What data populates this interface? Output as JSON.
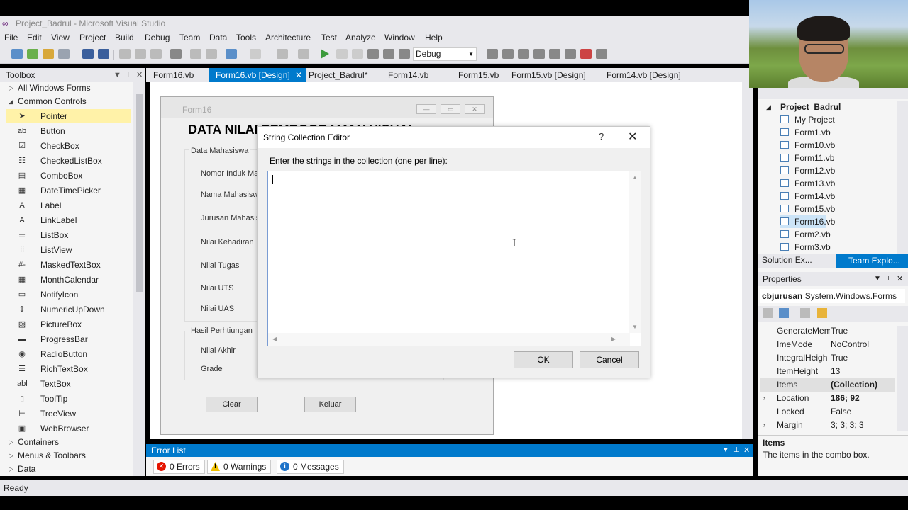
{
  "window": {
    "title": "Project_Badrul - Microsoft Visual Studio"
  },
  "menu": [
    "File",
    "Edit",
    "View",
    "Project",
    "Build",
    "Debug",
    "Team",
    "Data",
    "Tools",
    "Architecture",
    "Test",
    "Analyze",
    "Window",
    "Help"
  ],
  "toolbar": {
    "config_value": "Debug"
  },
  "toolbox": {
    "title": "Toolbox",
    "groups": {
      "all": "All Windows Forms",
      "common": "Common Controls",
      "containers": "Containers",
      "menus": "Menus & Toolbars",
      "data": "Data"
    },
    "items": [
      {
        "label": "Pointer",
        "icon": "pointer-icon",
        "glyph": "➤"
      },
      {
        "label": "Button",
        "icon": "button-icon",
        "glyph": "ab"
      },
      {
        "label": "CheckBox",
        "icon": "checkbox-icon",
        "glyph": "☑"
      },
      {
        "label": "CheckedListBox",
        "icon": "checkedlistbox-icon",
        "glyph": "☷"
      },
      {
        "label": "ComboBox",
        "icon": "combobox-icon",
        "glyph": "▤"
      },
      {
        "label": "DateTimePicker",
        "icon": "datetimepicker-icon",
        "glyph": "▦"
      },
      {
        "label": "Label",
        "icon": "label-icon",
        "glyph": "A"
      },
      {
        "label": "LinkLabel",
        "icon": "linklabel-icon",
        "glyph": "A"
      },
      {
        "label": "ListBox",
        "icon": "listbox-icon",
        "glyph": "☰"
      },
      {
        "label": "ListView",
        "icon": "listview-icon",
        "glyph": "⁞⁞"
      },
      {
        "label": "MaskedTextBox",
        "icon": "maskedtextbox-icon",
        "glyph": "#-"
      },
      {
        "label": "MonthCalendar",
        "icon": "monthcalendar-icon",
        "glyph": "▦"
      },
      {
        "label": "NotifyIcon",
        "icon": "notifyicon-icon",
        "glyph": "▭"
      },
      {
        "label": "NumericUpDown",
        "icon": "numericupdown-icon",
        "glyph": "⇕"
      },
      {
        "label": "PictureBox",
        "icon": "picturebox-icon",
        "glyph": "▨"
      },
      {
        "label": "ProgressBar",
        "icon": "progressbar-icon",
        "glyph": "▬"
      },
      {
        "label": "RadioButton",
        "icon": "radiobutton-icon",
        "glyph": "◉"
      },
      {
        "label": "RichTextBox",
        "icon": "richtextbox-icon",
        "glyph": "☰"
      },
      {
        "label": "TextBox",
        "icon": "textbox-icon",
        "glyph": "abl"
      },
      {
        "label": "ToolTip",
        "icon": "tooltip-icon",
        "glyph": "▯"
      },
      {
        "label": "TreeView",
        "icon": "treeview-icon",
        "glyph": "⊢"
      },
      {
        "label": "WebBrowser",
        "icon": "webbrowser-icon",
        "glyph": "▣"
      }
    ]
  },
  "tabs": [
    "Form16.vb",
    "Form16.vb [Design]",
    "Project_Badrul*",
    "Form14.vb",
    "Form15.vb",
    "Form15.vb [Design]",
    "Form14.vb [Design]"
  ],
  "form": {
    "title": "Form16",
    "heading": "DATA NILAI PEMROGRAMAN VISUAL",
    "group1": "Data Mahasiswa",
    "fields": [
      "Nomor Induk Ma",
      "Nama Mahasiswa",
      "Jurusan Mahasis",
      "Nilai Kehadiran",
      "Nilai Tugas",
      "Nilai UTS",
      "Nilai UAS"
    ],
    "group2": "Hasil Perhtiungan",
    "results": [
      "Nilai Akhir",
      "Grade"
    ],
    "clear": "Clear",
    "exit": "Keluar"
  },
  "dialog": {
    "title": "String Collection Editor",
    "help": "?",
    "prompt": "Enter the strings in the collection (one per line):",
    "content": "",
    "ok": "OK",
    "cancel": "Cancel"
  },
  "errorlist": {
    "title": "Error List",
    "errors": "0 Errors",
    "warnings": "0 Warnings",
    "messages": "0 Messages"
  },
  "solution": {
    "root": "Project_Badrul",
    "items": [
      "My Project",
      "Form1.vb",
      "Form10.vb",
      "Form11.vb",
      "Form12.vb",
      "Form13.vb",
      "Form14.vb",
      "Form15.vb",
      "Form16.vb",
      "Form2.vb",
      "Form3.vb"
    ],
    "tab1": "Solution Ex...",
    "tab2": "Team Explo..."
  },
  "properties": {
    "title": "Properties",
    "object": "cbjurusan",
    "object_type": "System.Windows.Forms",
    "rows": [
      {
        "name": "GenerateMem",
        "value": "True"
      },
      {
        "name": "ImeMode",
        "value": "NoControl"
      },
      {
        "name": "IntegralHeigh",
        "value": "True"
      },
      {
        "name": "ItemHeight",
        "value": "13"
      },
      {
        "name": "Items",
        "value": "(Collection)"
      },
      {
        "name": "Location",
        "value": "186; 92"
      },
      {
        "name": "Locked",
        "value": "False"
      },
      {
        "name": "Margin",
        "value": "3; 3; 3; 3"
      }
    ],
    "desc_title": "Items",
    "desc_text": "The items in the combo box."
  },
  "status": "Ready",
  "colors": {
    "accent": "#007acc",
    "selected_item": "#fff2a8"
  }
}
